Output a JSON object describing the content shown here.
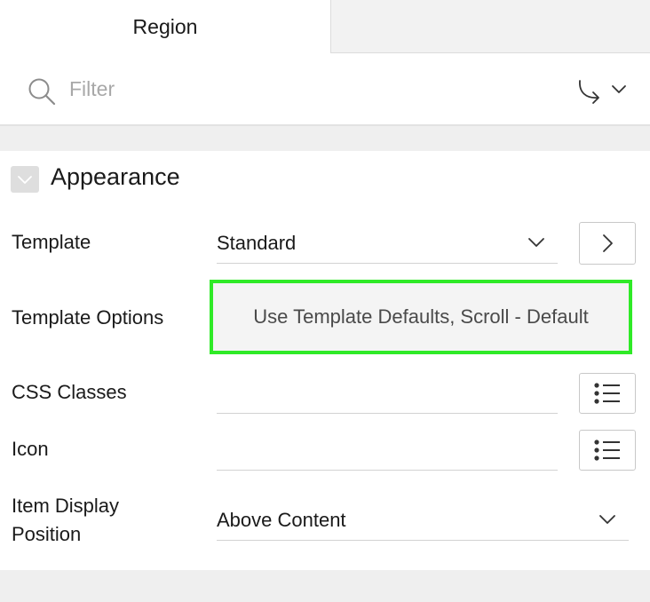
{
  "tabs": {
    "active_label": "Region"
  },
  "filter": {
    "placeholder": "Filter",
    "search_icon": "search-icon",
    "goto_icon": "go-to-group-icon"
  },
  "section": {
    "title": "Appearance",
    "fields": {
      "template": {
        "label": "Template",
        "value": "Standard"
      },
      "template_options": {
        "label": "Template Options",
        "value": "Use Template Defaults, Scroll - Default"
      },
      "css_classes": {
        "label": "CSS Classes",
        "value": ""
      },
      "icon": {
        "label": "Icon",
        "value": ""
      },
      "item_display_position": {
        "label_line1": "Item Display",
        "label_line2": "Position",
        "value": "Above Content"
      }
    }
  },
  "colors": {
    "highlight_border": "#2fea27"
  }
}
